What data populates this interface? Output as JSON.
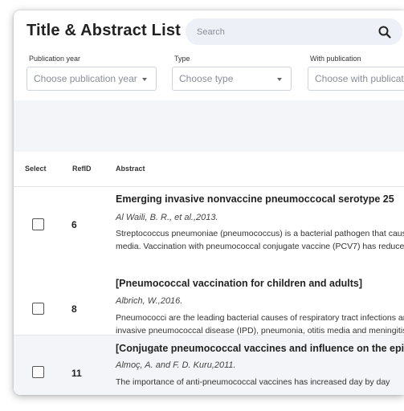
{
  "page_title": "Title & Abstract List",
  "search": {
    "placeholder": "Search",
    "value": ""
  },
  "filters": [
    {
      "label": "Publication year",
      "placeholder": "Choose publication year"
    },
    {
      "label": "Type",
      "placeholder": "Choose type"
    },
    {
      "label": "With publication",
      "placeholder": "Choose with publication"
    }
  ],
  "table": {
    "columns": {
      "select": "Select",
      "refid": "RefID",
      "abstract": "Abstract"
    },
    "rows": [
      {
        "refid": "6",
        "title": "Emerging invasive nonvaccine pneumoccocal serotype 25",
        "authors": "Al Waili, B. R., et al.,2013.",
        "abstract_line1": "Streptococcus pneumoniae (pneumococcus) is a bacterial pathogen that causes pneumonia and otitis",
        "abstract_line2": "media. Vaccination with pneumococcal conjugate vaccine (PCV7) has reduced invasive disease",
        "checked": false
      },
      {
        "refid": "8",
        "title": "[Pneumococcal vaccination for children and adults]",
        "authors": "Albrich, W.,2016.",
        "abstract_line1": "Pneumococci are the leading bacterial causes of respiratory tract infections and",
        "abstract_line2": "invasive pneumococcal disease (IPD), pneumonia, otitis media and meningitis",
        "checked": false
      },
      {
        "refid": "11",
        "title": "[Conjugate pneumococcal vaccines and influence on the epidemiology]",
        "authors": "Almoç, A. and F. D. Kuru,2011.",
        "abstract_line1": "The importance of anti-pneumococcal vaccines has increased day by day",
        "abstract_line2": "",
        "checked": false
      }
    ]
  }
}
